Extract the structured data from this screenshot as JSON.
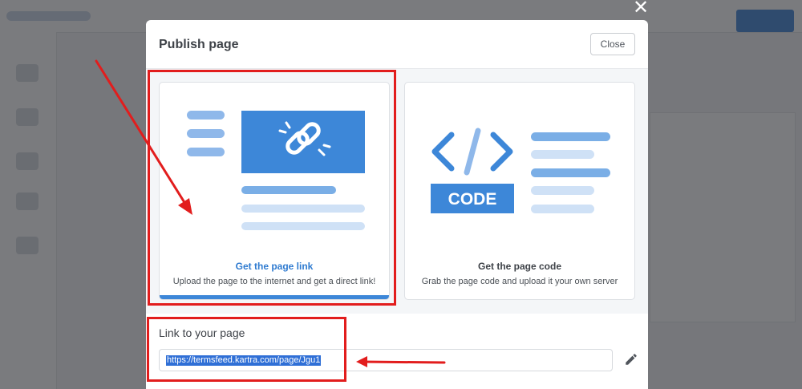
{
  "modal": {
    "title": "Publish page",
    "close_label": "Close",
    "close_x": "✕"
  },
  "options": [
    {
      "title": "Get the page link",
      "description": "Upload the page to the internet and get a direct link!",
      "selected": true
    },
    {
      "title": "Get the page code",
      "description": "Grab the page code and upload it your own server",
      "badge": "CODE",
      "selected": false
    }
  ],
  "link_section": {
    "label": "Link to your page",
    "url": "https://termsfeed.kartra.com/page/Jgu1"
  },
  "icons": {
    "link_card": "chain-link-icon",
    "code_card": "code-brackets-icon",
    "edit": "pencil-icon"
  },
  "colors": {
    "accent": "#3d87d8",
    "annotation": "#e21d1d",
    "selection": "#2f6fd6"
  }
}
